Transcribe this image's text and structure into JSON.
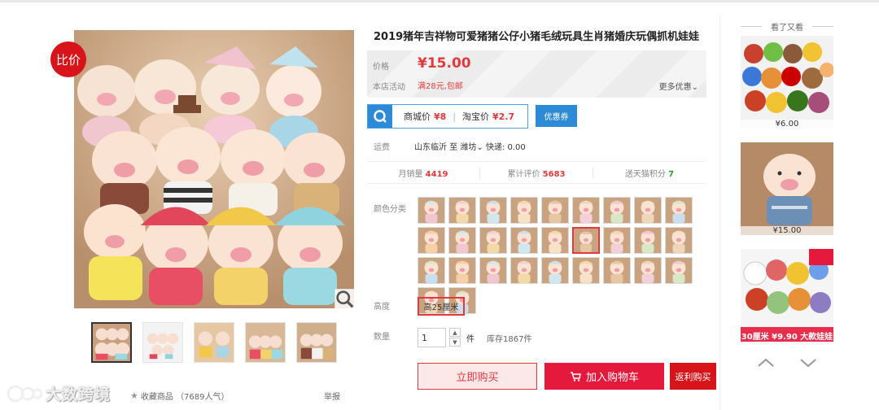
{
  "badge": {
    "compare": "比价"
  },
  "product": {
    "title": "2019猪年吉祥物可爱猪猪公仔小猪毛绒玩具生肖猪婚庆玩偶抓机娃娃"
  },
  "price_box": {
    "price_label": "价格",
    "price": "¥15.00",
    "promo_label": "本店活动",
    "promo": "满28元,包邮",
    "more": "更多优惠"
  },
  "compare_bar": {
    "mall_label": "商城价",
    "mall_price": "¥8",
    "taobao_label": "淘宝价",
    "taobao_price": "¥2.7",
    "coupon": "优惠券"
  },
  "shipping": {
    "label": "运费",
    "from": "山东临沂",
    "to_word": "至",
    "to": "潍坊",
    "express": "快递: 0.00"
  },
  "stats": {
    "monthly_label": "月销量",
    "monthly": "4419",
    "reviews_label": "累计评价",
    "reviews": "5683",
    "points_label": "送天猫积分",
    "points": "7"
  },
  "options": {
    "color_label": "颜色分类",
    "color_count": 29,
    "selected_index": 14,
    "height_label": "高度",
    "height_value": "高25厘米"
  },
  "quantity": {
    "label": "数量",
    "value": "1",
    "unit": "件",
    "stock": "库存1867件"
  },
  "actions": {
    "buy_now": "立即购买",
    "add_cart": "加入购物车",
    "rebate": "返利购买"
  },
  "footer": {
    "collect": "收藏商品 （7689人气）",
    "report": "举报",
    "watermark": "大数跨境"
  },
  "sidebar": {
    "title": "看了又看",
    "items": [
      {
        "price": "¥6.00"
      },
      {
        "price": "¥15.00"
      },
      {
        "price": "¥9.90",
        "banner": "30厘米",
        "banner2": "大款娃娃"
      }
    ]
  },
  "colors": {
    "accent": "#e4393c",
    "brand_blue": "#2c8ad6",
    "badge_red": "#d7141a"
  }
}
